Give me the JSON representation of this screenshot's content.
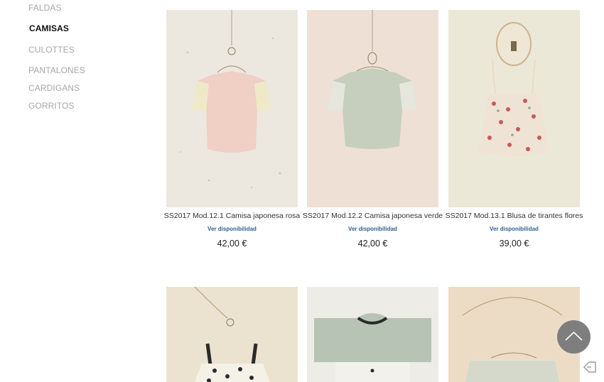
{
  "sidebar": {
    "categories": [
      {
        "label": "FALDAS",
        "active": false
      },
      {
        "label": "CAMISAS",
        "active": true
      },
      {
        "label": "CULOTTES",
        "active": false
      },
      {
        "label": "PANTALONES",
        "active": false
      },
      {
        "label": "CARDIGANS",
        "active": false
      },
      {
        "label": "GORRITOS",
        "active": false
      }
    ]
  },
  "products": [
    {
      "title": "SS2017 Mod.12.1 Camisa japonesa rosa",
      "availability": "Ver disponibilidad",
      "price": "42,00 €",
      "garment_color": "#f0cfc4"
    },
    {
      "title": "SS2017 Mod.12.2 Camisa japonesa verde",
      "availability": "Ver disponibilidad",
      "price": "42,00 €",
      "garment_color": "#c6cfbd"
    },
    {
      "title": "SS2017 Mod.13.1 Blusa de tirantes flores",
      "availability": "Ver disponibilidad",
      "price": "39,00 €",
      "garment_color": "#efe3d6"
    }
  ],
  "colors": {
    "link": "#2f5f93",
    "inactive_category": "#a6a6a6",
    "scroll_button": "#7e7e7e"
  },
  "icons": {
    "scroll_top": "chevron-up-icon",
    "corner": "tag-icon"
  }
}
